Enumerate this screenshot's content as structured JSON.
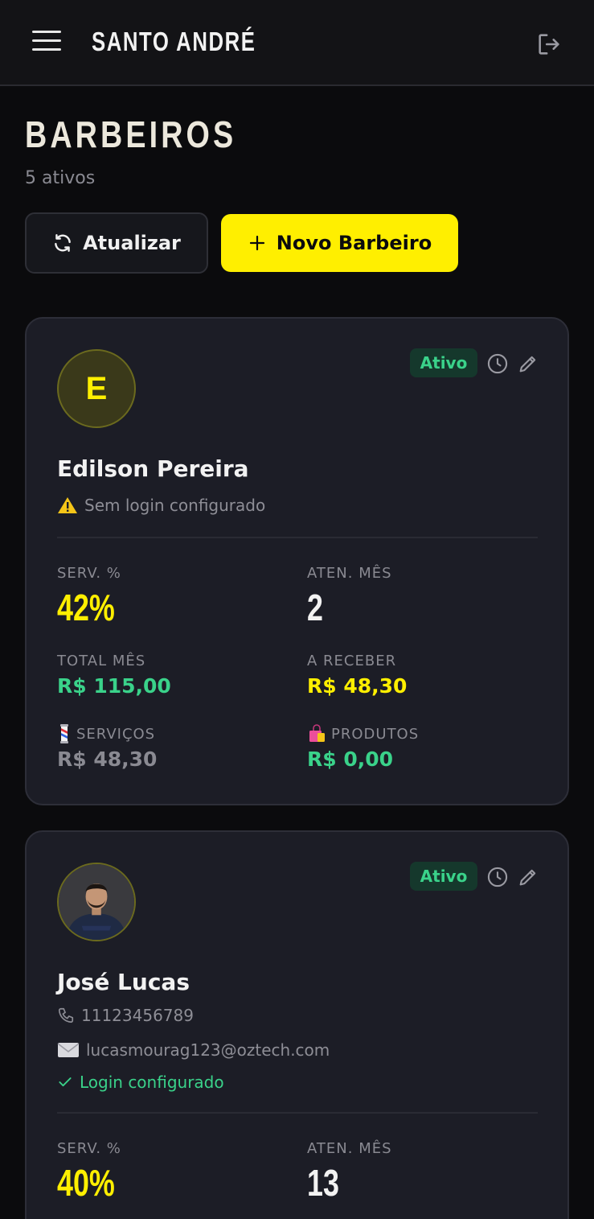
{
  "header": {
    "title": "SANTO ANDRÉ"
  },
  "page": {
    "title": "BARBEIROS",
    "subtitle": "5 ativos",
    "refresh_label": "Atualizar",
    "new_label": "Novo Barbeiro"
  },
  "colors": {
    "accent": "#ffef00",
    "success": "#3ad28a",
    "background": "#0b0b0d",
    "card": "#1c1d26"
  },
  "barbers": [
    {
      "initial": "E",
      "status": "Ativo",
      "name": "Edilson Pereira",
      "login_status": "Sem login configurado",
      "stats": {
        "serv_label": "SERV. %",
        "serv_value": "42%",
        "aten_label": "ATEN. MÊS",
        "aten_value": "2",
        "total_label": "TOTAL MÊS",
        "total_value": "R$ 115,00",
        "receber_label": "A RECEBER",
        "receber_value": "R$ 48,30",
        "servicos_label": "SERVIÇOS",
        "servicos_value": "R$ 48,30",
        "produtos_label": "PRODUTOS",
        "produtos_value": "R$ 0,00"
      }
    },
    {
      "status": "Ativo",
      "name": "José Lucas",
      "phone": "11123456789",
      "email": "lucasmourag123@oztech.com",
      "login_status": "Login configurado",
      "stats": {
        "serv_label": "SERV. %",
        "serv_value": "40%",
        "aten_label": "ATEN. MÊS",
        "aten_value": "13"
      }
    }
  ]
}
